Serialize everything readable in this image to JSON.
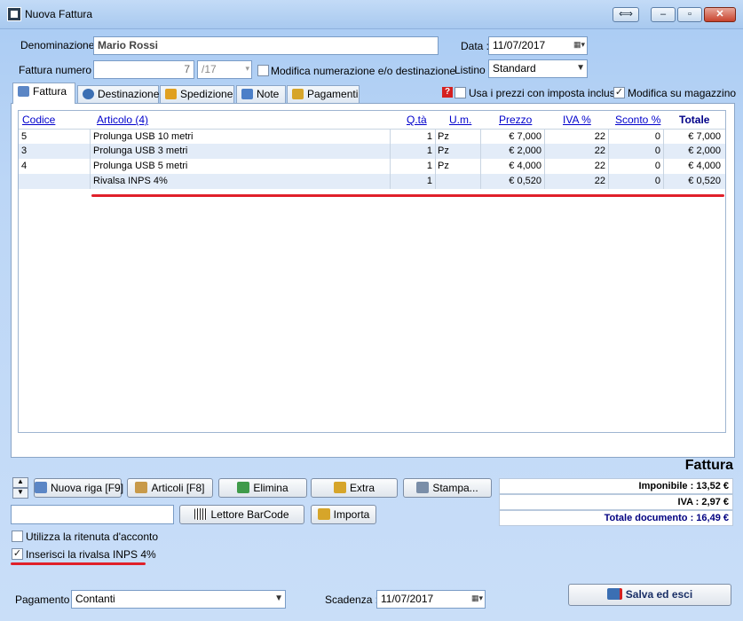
{
  "window": {
    "title": "Nuova Fattura"
  },
  "header": {
    "denominazione_label": "Denominazione :",
    "denominazione_value": "Mario Rossi",
    "data_label": "Data :",
    "data_value": "11/07/2017",
    "fattura_numero_label": "Fattura numero :",
    "fattura_numero_value": "7",
    "fattura_suffix": "/17",
    "modifica_numerazione_label": "Modifica numerazione e/o destinazione",
    "modifica_numerazione_checked": false,
    "listino_label": "Listino :",
    "listino_value": "Standard"
  },
  "tabs": [
    {
      "label": "Fattura",
      "active": true
    },
    {
      "label": "Destinazione",
      "active": false
    },
    {
      "label": "Spedizione",
      "active": false
    },
    {
      "label": "Note",
      "active": false
    },
    {
      "label": "Pagamenti",
      "active": false
    }
  ],
  "options": {
    "usa_prezzi_label": "Usa i prezzi con imposta inclusa",
    "usa_prezzi_checked": false,
    "modifica_magazzino_label": "Modifica su magazzino",
    "modifica_magazzino_checked": true
  },
  "table": {
    "columns": [
      "Codice",
      "Articolo (4)",
      "Q.tà",
      "U.m.",
      "Prezzo",
      "IVA %",
      "Sconto %",
      "Totale"
    ],
    "rows": [
      {
        "codice": "5",
        "articolo": "Prolunga USB 10 metri",
        "qta": "1",
        "um": "Pz",
        "prezzo": "€ 7,000",
        "iva": "22",
        "sconto": "0",
        "totale": "€ 7,000"
      },
      {
        "codice": "3",
        "articolo": "Prolunga USB 3 metri",
        "qta": "1",
        "um": "Pz",
        "prezzo": "€ 2,000",
        "iva": "22",
        "sconto": "0",
        "totale": "€ 2,000"
      },
      {
        "codice": "4",
        "articolo": "Prolunga USB 5 metri",
        "qta": "1",
        "um": "Pz",
        "prezzo": "€ 4,000",
        "iva": "22",
        "sconto": "0",
        "totale": "€ 4,000"
      },
      {
        "codice": "",
        "articolo": "Rivalsa INPS 4%",
        "qta": "1",
        "um": "",
        "prezzo": "€ 0,520",
        "iva": "22",
        "sconto": "0",
        "totale": "€ 0,520"
      }
    ]
  },
  "toolbar": {
    "nuova_riga": "Nuova riga [F9]",
    "articoli": "Articoli [F8]",
    "elimina": "Elimina",
    "extra": "Extra",
    "stampa": "Stampa...",
    "lettore_barcode": "Lettore BarCode",
    "importa": "Importa"
  },
  "totals": {
    "heading": "Fattura",
    "imponibile": "Imponibile : 13,52 €",
    "iva": "IVA : 2,97 €",
    "totale_documento": "Totale documento : 16,49 €"
  },
  "footer": {
    "ritenuta_label": "Utilizza la ritenuta d'acconto",
    "ritenuta_checked": false,
    "rivalsa_label": "Inserisci la rivalsa INPS 4%",
    "rivalsa_checked": true,
    "pagamento_label": "Pagamento :",
    "pagamento_value": "Contanti",
    "scadenza_label": "Scadenza :",
    "scadenza_value": "11/07/2017",
    "salva_label": "Salva ed esci"
  },
  "colors": {
    "accent_red": "#e0202a",
    "link_blue": "#0000cc"
  }
}
